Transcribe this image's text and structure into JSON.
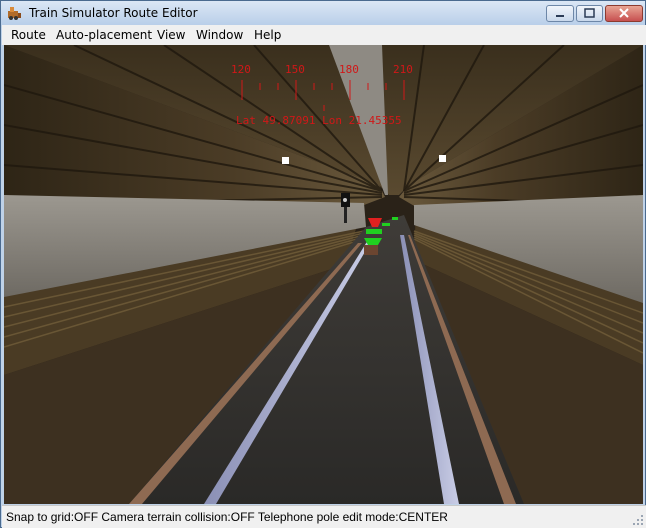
{
  "window": {
    "title": "Train Simulator Route Editor"
  },
  "menu": [
    "Route",
    "Auto-placement",
    "View",
    "Window",
    "Help"
  ],
  "compass": {
    "ticks": [
      "120",
      "150",
      "180",
      "210"
    ]
  },
  "coords": "Lat 49.87091 Lon 21.45355",
  "status": "Snap to grid:OFF Camera terrain collision:OFF Telephone pole edit mode:CENTER",
  "colors": {
    "hud": "#d01818",
    "signal_red": "#e02020",
    "signal_green": "#20d020"
  }
}
